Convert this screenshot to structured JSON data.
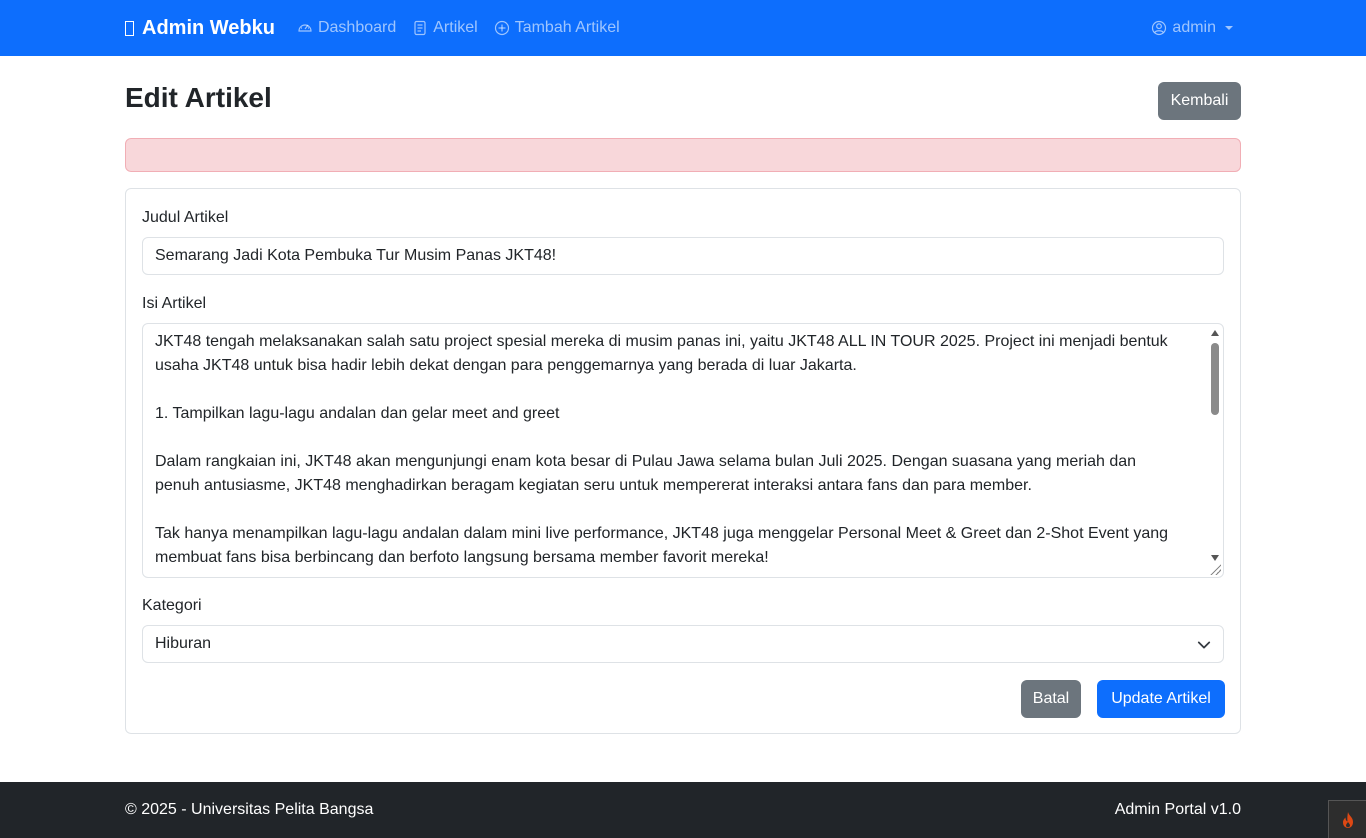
{
  "navbar": {
    "brand": "Admin Webku",
    "links": [
      {
        "label": "Dashboard",
        "icon": "speedometer-icon"
      },
      {
        "label": "Artikel",
        "icon": "document-icon"
      },
      {
        "label": "Tambah Artikel",
        "icon": "plus-circle-icon"
      }
    ],
    "user": "admin"
  },
  "page": {
    "title": "Edit Artikel",
    "back_label": "Kembali"
  },
  "form": {
    "title_label": "Judul Artikel",
    "title_value": "Semarang Jadi Kota Pembuka Tur Musim Panas JKT48!",
    "content_label": "Isi Artikel",
    "content_value": "JKT48 tengah melaksanakan salah satu project spesial mereka di musim panas ini, yaitu JKT48 ALL IN TOUR 2025. Project ini menjadi bentuk usaha JKT48 untuk bisa hadir lebih dekat dengan para penggemarnya yang berada di luar Jakarta.\n\n1. Tampilkan lagu-lagu andalan dan gelar meet and greet\n\nDalam rangkaian ini, JKT48 akan mengunjungi enam kota besar di Pulau Jawa selama bulan Juli 2025. Dengan suasana yang meriah dan penuh antusiasme, JKT48 menghadirkan beragam kegiatan seru untuk mempererat interaksi antara fans dan para member.\n\nTak hanya menampilkan lagu-lagu andalan dalam mini live performance, JKT48 juga menggelar Personal Meet & Greet dan 2-Shot Event yang membuat fans bisa berbincang dan berfoto langsung bersama member favorit mereka!",
    "category_label": "Kategori",
    "category_value": "Hiburan",
    "cancel_label": "Batal",
    "submit_label": "Update Artikel"
  },
  "footer": {
    "copyright": "© 2025 - Universitas Pelita Bangsa",
    "version": "Admin Portal v1.0"
  },
  "colors": {
    "primary": "#0d6efd",
    "secondary": "#6c757d",
    "alert_bg": "#f8d7da",
    "footer_bg": "#212529"
  }
}
